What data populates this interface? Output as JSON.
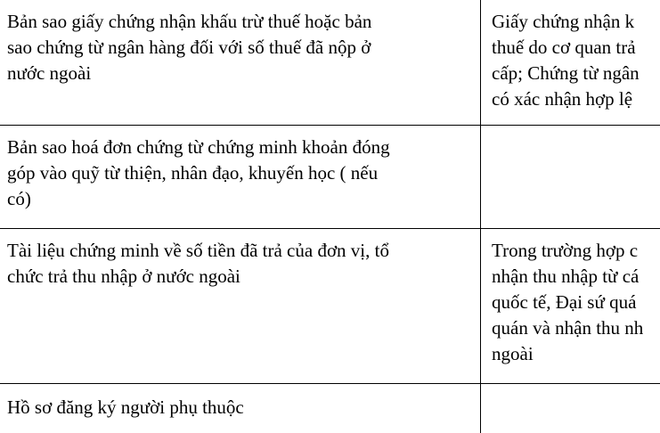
{
  "table": {
    "rows": [
      {
        "left": [
          "Bản sao giấy chứng nhận khấu trừ thuế hoặc bản",
          "sao chứng từ ngân hàng đối với số thuế đã nộp ở",
          "nước ngoài"
        ],
        "right": [
          "Giấy chứng nhận k",
          "thuế do cơ quan trả",
          "cấp; Chứng từ ngân",
          "có xác nhận hợp lệ"
        ]
      },
      {
        "left": [
          "Bản sao hoá đơn chứng từ chứng minh khoản đóng",
          "góp vào quỹ từ thiện, nhân đạo, khuyến học ( nếu",
          "có)"
        ],
        "right": []
      },
      {
        "left": [
          "Tài liệu chứng minh về số tiền đã trả của đơn vị, tổ",
          "chức trả thu nhập ở nước ngoài"
        ],
        "right": [
          "Trong trường hợp c",
          "nhận thu nhập từ cá",
          "quốc tế, Đại sứ quá",
          "quán và nhận thu nh",
          "ngoài"
        ]
      },
      {
        "left": [
          "Hồ sơ đăng ký người phụ thuộc"
        ],
        "right": []
      }
    ]
  }
}
